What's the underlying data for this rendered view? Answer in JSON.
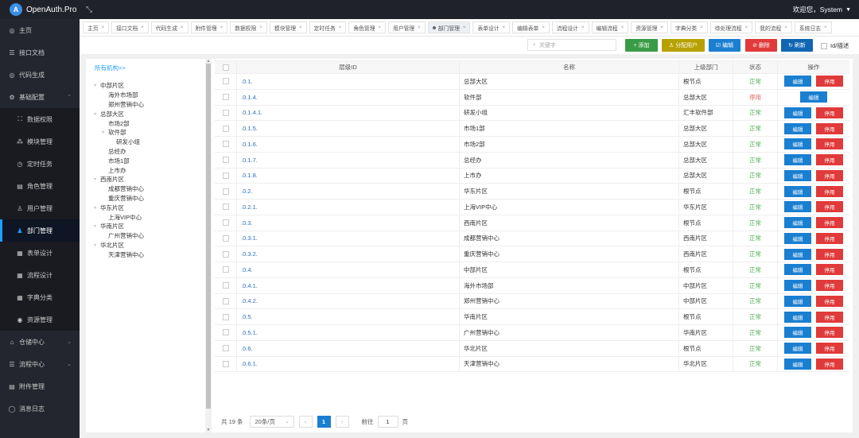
{
  "app": {
    "logo_letter": "A",
    "title": "OpenAuth.Pro",
    "collapse_icon": "collapse-icon",
    "welcome": "欢迎您，System"
  },
  "sidebar": {
    "items": [
      {
        "label": "主页",
        "icon": "home-icon",
        "glyph": "◎"
      },
      {
        "label": "接口文档",
        "icon": "doc-icon",
        "glyph": "☰"
      },
      {
        "label": "代码生成",
        "icon": "check-circle-icon",
        "glyph": "◎"
      },
      {
        "label": "基础配置",
        "icon": "gear-icon",
        "glyph": "⚙",
        "expanded": true
      }
    ],
    "sub_items": [
      {
        "label": "数据权限",
        "icon": "data-icon",
        "glyph": "⛶"
      },
      {
        "label": "模块管理",
        "icon": "module-icon",
        "glyph": "⁂"
      },
      {
        "label": "定时任务",
        "icon": "timer-icon",
        "glyph": "◷"
      },
      {
        "label": "角色管理",
        "icon": "role-icon",
        "glyph": "▤"
      },
      {
        "label": "用户管理",
        "icon": "user-icon",
        "glyph": "♙"
      },
      {
        "label": "部门管理",
        "icon": "dept-icon",
        "glyph": "♟",
        "active": true
      },
      {
        "label": "表单设计",
        "icon": "form-icon",
        "glyph": "▦"
      },
      {
        "label": "流程设计",
        "icon": "flow-icon",
        "glyph": "▦"
      },
      {
        "label": "字典分类",
        "icon": "dict-icon",
        "glyph": "▦"
      },
      {
        "label": "资源管理",
        "icon": "resource-icon",
        "glyph": "◉"
      }
    ],
    "bottom_items": [
      {
        "label": "仓储中心",
        "icon": "warehouse-icon",
        "glyph": "⌂"
      },
      {
        "label": "流程中心",
        "icon": "process-icon",
        "glyph": "☰"
      },
      {
        "label": "附件管理",
        "icon": "attachment-icon",
        "glyph": "▤"
      },
      {
        "label": "消息日志",
        "icon": "message-icon",
        "glyph": "◯"
      }
    ]
  },
  "tabs": [
    {
      "label": "主页"
    },
    {
      "label": "接口文档"
    },
    {
      "label": "代码生成"
    },
    {
      "label": "附件管理"
    },
    {
      "label": "数据权限"
    },
    {
      "label": "模块管理"
    },
    {
      "label": "定时任务"
    },
    {
      "label": "角色管理"
    },
    {
      "label": "用户管理"
    },
    {
      "label": "部门管理",
      "active": true
    },
    {
      "label": "表单设计"
    },
    {
      "label": "编辑表单"
    },
    {
      "label": "流程设计"
    },
    {
      "label": "编辑流程"
    },
    {
      "label": "资源管理"
    },
    {
      "label": "字典分类"
    },
    {
      "label": "待处理流程"
    },
    {
      "label": "我的流程"
    },
    {
      "label": "系统日志"
    }
  ],
  "toolbar": {
    "search_placeholder": "关键字",
    "add": "+ 添加",
    "assign": "♙ 分配用户",
    "edit": "☑ 编辑",
    "delete": "⊘ 删除",
    "refresh": "↻ 刷新",
    "id_desc": "Id/描述"
  },
  "tree": {
    "all": "所有机构>>",
    "nodes": [
      {
        "label": "中部片区",
        "level": 0,
        "toggle": "▿"
      },
      {
        "label": "海外市场部",
        "level": 1,
        "toggle": ""
      },
      {
        "label": "郑州营销中心",
        "level": 1,
        "toggle": ""
      },
      {
        "label": "总部大区",
        "level": 0,
        "toggle": "▿"
      },
      {
        "label": "市场2部",
        "level": 1,
        "toggle": ""
      },
      {
        "label": "软件部",
        "level": 1,
        "toggle": "▿"
      },
      {
        "label": "研发小组",
        "level": 2,
        "toggle": ""
      },
      {
        "label": "总经办",
        "level": 1,
        "toggle": ""
      },
      {
        "label": "市场1部",
        "level": 1,
        "toggle": ""
      },
      {
        "label": "上市办",
        "level": 1,
        "toggle": ""
      },
      {
        "label": "西南片区",
        "level": 0,
        "toggle": "▿"
      },
      {
        "label": "成都营销中心",
        "level": 1,
        "toggle": ""
      },
      {
        "label": "重庆营销中心",
        "level": 1,
        "toggle": ""
      },
      {
        "label": "华东片区",
        "level": 0,
        "toggle": "▿"
      },
      {
        "label": "上海VIP中心",
        "level": 1,
        "toggle": ""
      },
      {
        "label": "华南片区",
        "level": 0,
        "toggle": "▿"
      },
      {
        "label": "广州营销中心",
        "level": 1,
        "toggle": ""
      },
      {
        "label": "华北片区",
        "level": 0,
        "toggle": "▿"
      },
      {
        "label": "天津营销中心",
        "level": 1,
        "toggle": ""
      }
    ]
  },
  "table": {
    "headers": [
      "层级ID",
      "名称",
      "上级部门",
      "状态",
      "操作"
    ],
    "edit_label": "编辑",
    "stop_label": "停用",
    "rows": [
      {
        "id": ".0.1.",
        "name": "总部大区",
        "parent": "根节点",
        "status": "正常",
        "ok": true
      },
      {
        "id": ".0.1.4.",
        "name": "软件部",
        "parent": "总部大区",
        "status": "停用",
        "ok": false
      },
      {
        "id": ".0.1.4.1.",
        "name": "研发小组",
        "parent": "汇丰软件部",
        "status": "正常",
        "ok": true
      },
      {
        "id": ".0.1.5.",
        "name": "市场1部",
        "parent": "总部大区",
        "status": "正常",
        "ok": true
      },
      {
        "id": ".0.1.6.",
        "name": "市场2部",
        "parent": "总部大区",
        "status": "正常",
        "ok": true
      },
      {
        "id": ".0.1.7.",
        "name": "总经办",
        "parent": "总部大区",
        "status": "正常",
        "ok": true
      },
      {
        "id": ".0.1.8.",
        "name": "上市办",
        "parent": "总部大区",
        "status": "正常",
        "ok": true
      },
      {
        "id": ".0.2.",
        "name": "华东片区",
        "parent": "根节点",
        "status": "正常",
        "ok": true
      },
      {
        "id": ".0.2.1.",
        "name": "上海VIP中心",
        "parent": "华东片区",
        "status": "正常",
        "ok": true
      },
      {
        "id": ".0.3.",
        "name": "西南片区",
        "parent": "根节点",
        "status": "正常",
        "ok": true
      },
      {
        "id": ".0.3.1.",
        "name": "成都营销中心",
        "parent": "西南片区",
        "status": "正常",
        "ok": true
      },
      {
        "id": ".0.3.2.",
        "name": "重庆营销中心",
        "parent": "西南片区",
        "status": "正常",
        "ok": true
      },
      {
        "id": ".0.4.",
        "name": "中部片区",
        "parent": "根节点",
        "status": "正常",
        "ok": true
      },
      {
        "id": ".0.4.1.",
        "name": "海外市场部",
        "parent": "中部片区",
        "status": "正常",
        "ok": true
      },
      {
        "id": ".0.4.2.",
        "name": "郑州营销中心",
        "parent": "中部片区",
        "status": "正常",
        "ok": true
      },
      {
        "id": ".0.5.",
        "name": "华南片区",
        "parent": "根节点",
        "status": "正常",
        "ok": true
      },
      {
        "id": ".0.5.1.",
        "name": "广州营销中心",
        "parent": "华南片区",
        "status": "正常",
        "ok": true
      },
      {
        "id": ".0.6.",
        "name": "华北片区",
        "parent": "根节点",
        "status": "正常",
        "ok": true
      },
      {
        "id": ".0.6.1.",
        "name": "天津营销中心",
        "parent": "华北片区",
        "status": "正常",
        "ok": true
      }
    ]
  },
  "pager": {
    "total": "共 19 条",
    "size": "20条/页",
    "prev": "‹",
    "current": "1",
    "next": "›",
    "goto": "前往",
    "goto_value": "1",
    "page_unit": "页"
  },
  "colors": {
    "accent": "#1E9FFF",
    "ok": "#4CAF50",
    "danger": "#e03a3a",
    "sidebar": "#23262e"
  }
}
